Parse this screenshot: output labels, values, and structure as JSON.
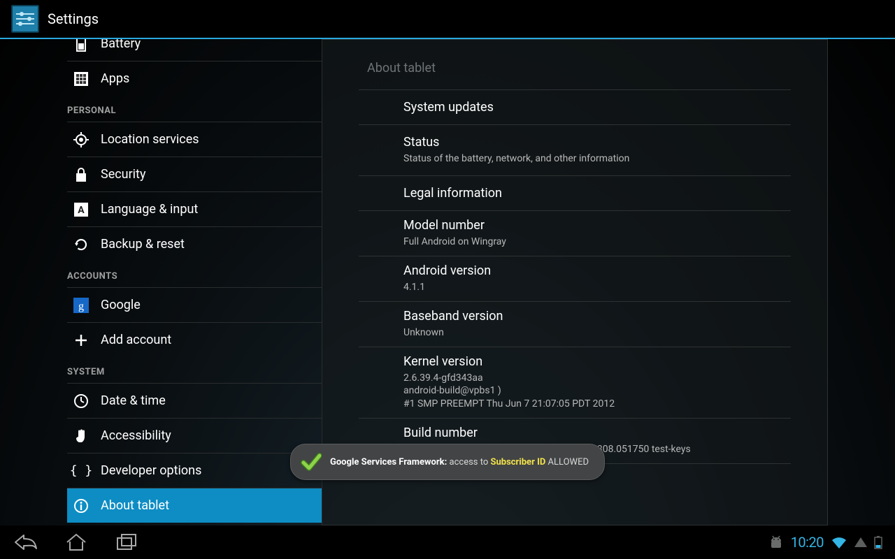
{
  "actionbar": {
    "title": "Settings"
  },
  "sidebar": {
    "scrolled": [
      {
        "key": "battery",
        "label": "Battery",
        "icon": "battery-icon"
      },
      {
        "key": "apps",
        "label": "Apps",
        "icon": "apps-icon"
      }
    ],
    "headers": {
      "personal": "PERSONAL",
      "accounts": "ACCOUNTS",
      "system": "SYSTEM"
    },
    "personal": [
      {
        "key": "location",
        "label": "Location services",
        "icon": "location-icon"
      },
      {
        "key": "security",
        "label": "Security",
        "icon": "lock-icon"
      },
      {
        "key": "language",
        "label": "Language & input",
        "icon": "language-icon"
      },
      {
        "key": "backup",
        "label": "Backup & reset",
        "icon": "refresh-icon"
      }
    ],
    "accounts": [
      {
        "key": "google",
        "label": "Google",
        "icon": "google-icon"
      },
      {
        "key": "add",
        "label": "Add account",
        "icon": "plus-icon"
      }
    ],
    "system": [
      {
        "key": "datetime",
        "label": "Date & time",
        "icon": "clock-icon"
      },
      {
        "key": "accessibility",
        "label": "Accessibility",
        "icon": "hand-icon"
      },
      {
        "key": "developer",
        "label": "Developer options",
        "icon": "braces-icon"
      },
      {
        "key": "about",
        "label": "About tablet",
        "icon": "info-icon",
        "selected": true
      }
    ]
  },
  "detail": {
    "title": "About tablet",
    "items": [
      {
        "title": "System updates"
      },
      {
        "title": "Status",
        "summary": "Status of the battery, network, and other information"
      },
      {
        "title": "Legal information"
      },
      {
        "title": "Model number",
        "summary": "Full Android on Wingray"
      },
      {
        "title": "Android version",
        "summary": "4.1.1"
      },
      {
        "title": "Baseband version",
        "summary": "Unknown"
      },
      {
        "title": "Kernel version",
        "summary": "2.6.39.4-gfd343aa\nandroid-build@vpbs1 )\n#1 SMP PREEMPT Thu Jun 7 21:07:05 PDT 2012"
      },
      {
        "title": "Build number",
        "summary": ".babil.20120808.051750 test-keys"
      }
    ]
  },
  "toast": {
    "prefix_bold": "Google Services Framework: ",
    "mid": "access to ",
    "highlight": "Subscriber ID",
    "suffix": " ALLOWED"
  },
  "navbar": {
    "clock": "10:20"
  }
}
